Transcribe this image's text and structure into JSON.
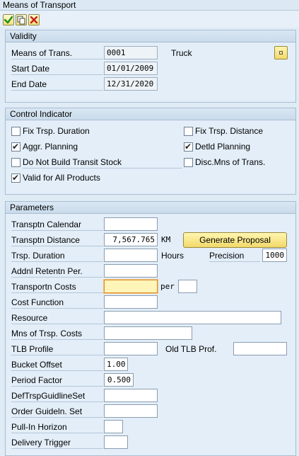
{
  "window": {
    "title": "Means of Transport"
  },
  "toolbar": {
    "icons": [
      "check-icon",
      "copy-icon",
      "close-icon"
    ]
  },
  "validity": {
    "title": "Validity",
    "means_label": "Means of Trans.",
    "means_value": "0001",
    "means_desc": "Truck",
    "start_label": "Start Date",
    "start_value": "01/01/2009",
    "end_label": "End Date",
    "end_value": "12/31/2020"
  },
  "control": {
    "title": "Control Indicator",
    "fix_duration": {
      "label": "Fix Trsp. Duration",
      "checked": false
    },
    "fix_distance": {
      "label": "Fix Trsp. Distance",
      "checked": false
    },
    "aggr_planning": {
      "label": "Aggr. Planning",
      "checked": true
    },
    "detld_planning": {
      "label": "Detld Planning",
      "checked": true
    },
    "no_transit": {
      "label": "Do Not Build Transit Stock",
      "checked": false
    },
    "disc_mns": {
      "label": "Disc.Mns of Trans.",
      "checked": false
    },
    "valid_all": {
      "label": "Valid for All Products",
      "checked": true
    }
  },
  "parameters": {
    "title": "Parameters",
    "calendar_label": "Transptn Calendar",
    "calendar_value": "",
    "distance_label": "Transptn Distance",
    "distance_value": "7,567.765",
    "distance_unit": "KM",
    "generate_label": "Generate Proposal",
    "duration_label": "Trsp. Duration",
    "duration_value": "",
    "duration_unit": "Hours",
    "precision_label": "Precision",
    "precision_value": "1000",
    "retention_label": "Addnl Retentn Per.",
    "retention_value": "",
    "costs_label": "Transportn Costs",
    "costs_value": "",
    "per_label": "per",
    "per_value": "",
    "cost_fn_label": "Cost Function",
    "cost_fn_value": "",
    "resource_label": "Resource",
    "resource_value": "",
    "mns_costs_label": "Mns of Trsp. Costs",
    "mns_costs_value": "",
    "tlb_label": "TLB Profile",
    "tlb_value": "",
    "old_tlb_label": "Old TLB Prof.",
    "old_tlb_value": "",
    "bucket_label": "Bucket Offset",
    "bucket_value": "1.00",
    "period_label": "Period Factor",
    "period_value": "0.500",
    "guideline_label": "DefTrspGuidlineSet",
    "guideline_value": "",
    "order_label": "Order Guideln. Set",
    "order_value": "",
    "pullin_label": "Pull-In Horizon",
    "pullin_value": "",
    "delivery_label": "Delivery Trigger",
    "delivery_value": ""
  },
  "colors": {
    "background": "#dfebf5",
    "group_header": "#c9dbeb",
    "button_yellow": "#f2d96a",
    "focus_field": "#fff5b8"
  }
}
